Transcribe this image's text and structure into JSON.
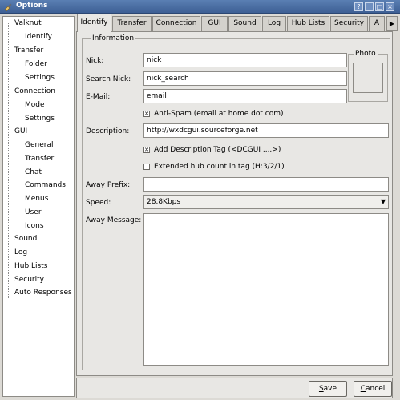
{
  "window": {
    "title": "Options",
    "buttons": [
      "?",
      "_",
      "□",
      "×"
    ]
  },
  "sidebar": {
    "items": [
      {
        "label": "Valknut",
        "level": 0
      },
      {
        "label": "Identify",
        "level": 1,
        "selected": true
      },
      {
        "label": "Transfer",
        "level": 0
      },
      {
        "label": "Folder",
        "level": 1
      },
      {
        "label": "Settings",
        "level": 1
      },
      {
        "label": "Connection",
        "level": 0
      },
      {
        "label": "Mode",
        "level": 1
      },
      {
        "label": "Settings",
        "level": 1
      },
      {
        "label": "GUI",
        "level": 0
      },
      {
        "label": "General",
        "level": 1
      },
      {
        "label": "Transfer",
        "level": 1
      },
      {
        "label": "Chat",
        "level": 1
      },
      {
        "label": "Commands",
        "level": 1
      },
      {
        "label": "Menus",
        "level": 1
      },
      {
        "label": "User",
        "level": 1
      },
      {
        "label": "Icons",
        "level": 1
      },
      {
        "label": "Sound",
        "level": 0
      },
      {
        "label": "Log",
        "level": 0
      },
      {
        "label": "Hub Lists",
        "level": 0
      },
      {
        "label": "Security",
        "level": 0
      },
      {
        "label": "Auto Responses",
        "level": 0
      }
    ]
  },
  "tabs": [
    "Identify",
    "Transfer",
    "Connection",
    "GUI",
    "Sound",
    "Log",
    "Hub Lists",
    "Security",
    "A"
  ],
  "active_tab": "Identify",
  "form": {
    "group_title": "Information",
    "nick_label": "Nick:",
    "nick_value": "nick",
    "search_nick_label": "Search Nick:",
    "search_nick_value": "nick_search",
    "email_label": "E-Mail:",
    "email_value": "email",
    "photo_label": "Photo",
    "antispam_label": "Anti-Spam (email at home dot com)",
    "antispam_checked": true,
    "description_label": "Description:",
    "description_value": "http://wxdcgui.sourceforge.net",
    "add_desc_tag_label": "Add Description Tag (<DCGUI ....>)",
    "add_desc_tag_checked": true,
    "extended_hub_label": "Extended hub count in tag (H:3/2/1)",
    "extended_hub_checked": false,
    "away_prefix_label": "Away Prefix:",
    "away_prefix_value": "",
    "speed_label": "Speed:",
    "speed_value": "28.8Kbps",
    "away_message_label": "Away Message:",
    "away_message_value": ""
  },
  "buttons": {
    "save_underlined": "S",
    "save_rest": "ave",
    "cancel_underlined": "C",
    "cancel_rest": "ancel"
  }
}
